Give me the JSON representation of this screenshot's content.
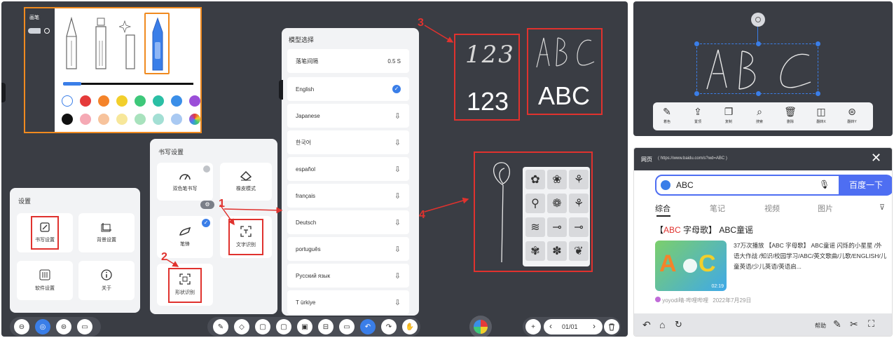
{
  "pen_panel": {
    "title": "画笔",
    "colors": [
      "#ffffff",
      "#e53a3a",
      "#f4832a",
      "#f2cf2b",
      "#3ec87a",
      "#2bbfa5",
      "#3a8ee8",
      "#9b4ed8",
      "#111111",
      "#f5a9b4",
      "#f7c39c",
      "#f7e79a",
      "#a8e2bd",
      "#a3dfd4",
      "#a9c9f2",
      "multicolor"
    ]
  },
  "writing_settings": {
    "title": "书写设置",
    "items": [
      "双色笔书写",
      "橡皮模式",
      "笔锋",
      "文字识别",
      "形状识别"
    ]
  },
  "settings_panel": {
    "title": "设置",
    "items": [
      "书写设置",
      "背景设置",
      "软件设置",
      "关于"
    ]
  },
  "model_panel": {
    "title": "模型选择",
    "interval_label": "落笔间隔",
    "interval_value": "0.5 S",
    "languages": [
      "English",
      "Japanese",
      "한국어",
      "español",
      "français",
      "Deutsch",
      "português",
      "Русский язык",
      "T ürkiye"
    ]
  },
  "annotations": {
    "n1": "1",
    "n2": "2",
    "n3": "3",
    "n4": "4"
  },
  "recognition": {
    "handwritten_digits": "123",
    "recognized_digits": "123",
    "recognized_letters": "ABC"
  },
  "bottom_left_tools": [
    "⊖",
    "◎",
    "⊜",
    "▭"
  ],
  "bottom_center_tools": [
    "✎",
    "◇",
    "▢",
    "▢",
    "▣",
    "⊟",
    "▭",
    "↶",
    "↷",
    "✋"
  ],
  "pager": {
    "plus": "+",
    "prev": "‹",
    "page": "01/01",
    "next": "›",
    "delete": "🗑"
  },
  "selection_toolbar": {
    "labels": [
      "着色",
      "置顶",
      "复制",
      "搜索",
      "删除",
      "翻转X",
      "翻转Y"
    ]
  },
  "web_panel": {
    "title": "网页",
    "url": "( https://www.baidu.com/s?wd=ABC )",
    "close": "✕",
    "query": "ABC",
    "search_button": "百度一下",
    "tabs": [
      "综合",
      "笔记",
      "视频",
      "图片"
    ],
    "result_title_prefix": "【",
    "result_title_highlight": "ABC",
    "result_title_rest": " 字母歌】 ABC童谣",
    "result_desc": "37万次播放 【ABC 字母歌】 ABC童谣 闪烁的小星星 /外语大作战 /知识/校园学习/ABC/英文歌曲/儿歌/ENGLISH/儿童英语/少儿英语/英语启...",
    "duration": "02:19",
    "author": "yoyodi晴·哔哩哔哩",
    "date": "2022年7月29日",
    "help": "帮助"
  }
}
